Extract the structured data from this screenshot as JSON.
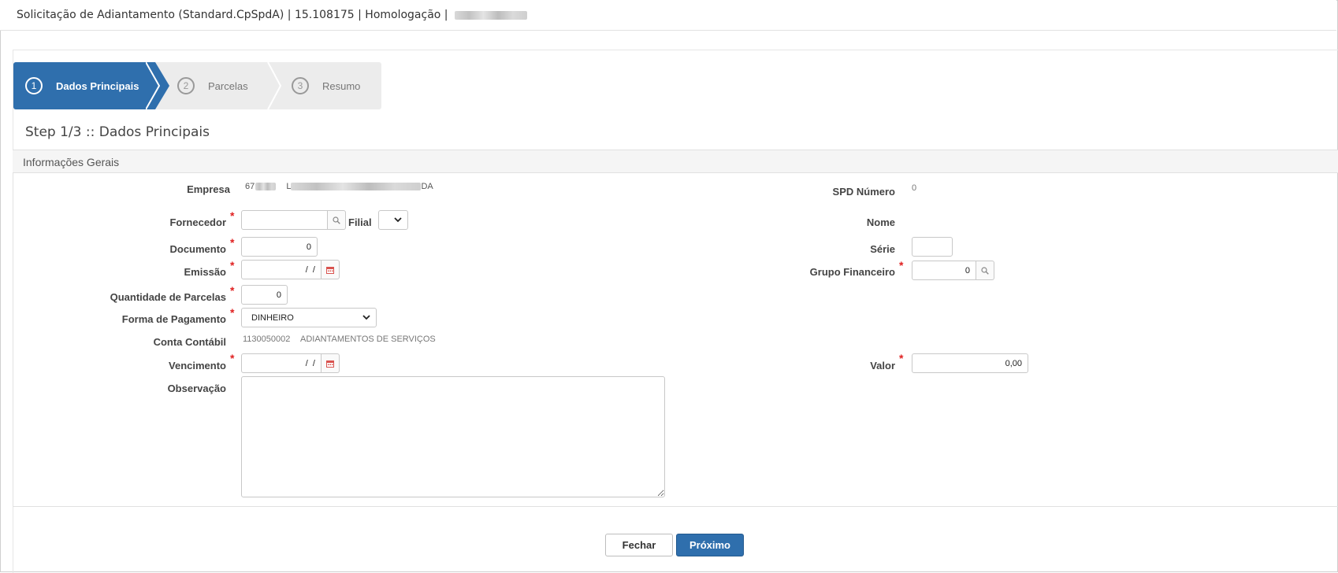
{
  "window": {
    "title": "Solicitação de Adiantamento (Standard.CpSpdA) | 15.108175 | Homologação |"
  },
  "wizard": {
    "steps": [
      {
        "number": "1",
        "label": "Dados Principais"
      },
      {
        "number": "2",
        "label": "Parcelas"
      },
      {
        "number": "3",
        "label": "Resumo"
      }
    ],
    "step_title": "Step 1/3 :: Dados Principais"
  },
  "section": {
    "title": "Informações Gerais"
  },
  "form": {
    "empresa": {
      "label": "Empresa",
      "code": "67",
      "name_prefix": "L",
      "name_suffix": "DA"
    },
    "spd_numero": {
      "label": "SPD Número",
      "value": "0"
    },
    "fornecedor": {
      "label": "Fornecedor",
      "value": ""
    },
    "filial": {
      "label": "Filial",
      "value": ""
    },
    "nome": {
      "label": "Nome"
    },
    "documento": {
      "label": "Documento",
      "value": "0"
    },
    "serie": {
      "label": "Série",
      "value": ""
    },
    "emissao": {
      "label": "Emissão",
      "value": "  /  /"
    },
    "grupo_financeiro": {
      "label": "Grupo Financeiro",
      "value": "0"
    },
    "quantidade_parcelas": {
      "label": "Quantidade de Parcelas",
      "value": "0"
    },
    "forma_pagamento": {
      "label": "Forma de Pagamento",
      "value": "DINHEIRO"
    },
    "conta_contabil": {
      "label": "Conta Contábil",
      "code": "1130050002",
      "description": "ADIANTAMENTOS DE SERVIÇOS"
    },
    "vencimento": {
      "label": "Vencimento",
      "value": "  /  /"
    },
    "valor": {
      "label": "Valor",
      "value": "0,00"
    },
    "observacao": {
      "label": "Observação",
      "value": ""
    },
    "required_mark": "*"
  },
  "buttons": {
    "fechar": "Fechar",
    "proximo": "Próximo"
  },
  "colors": {
    "primary": "#2f6fad",
    "required": "#e02020",
    "calendar": "#d9534f"
  },
  "icons": {
    "search": "magnifier-icon",
    "calendar": "calendar-icon"
  }
}
